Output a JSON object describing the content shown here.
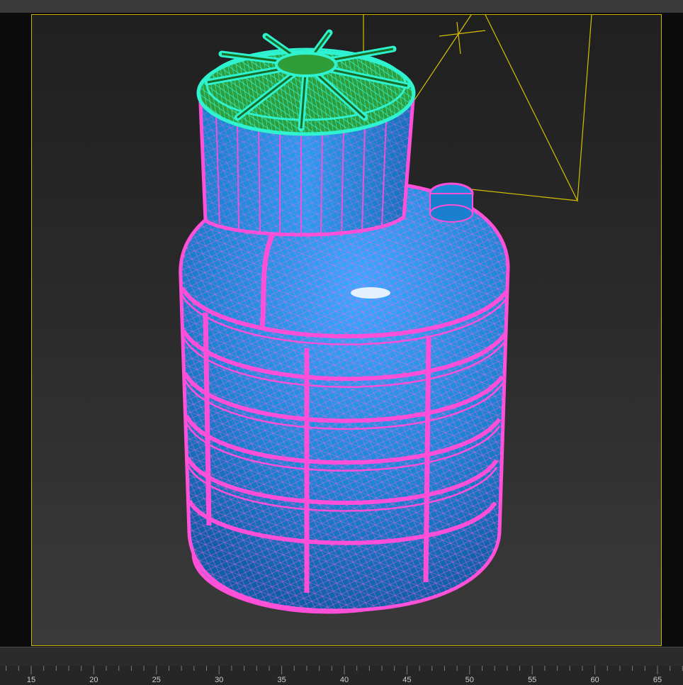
{
  "viewport": {
    "colors": {
      "frame": "#c9b200",
      "wire_pink": "#ff4fd8",
      "fill_blue": "#1e88d8",
      "lid_cyan": "#2ef2d0",
      "lid_green": "#2f9e3a"
    }
  },
  "timeline": {
    "ruler_ticks": [
      "15",
      "20",
      "25",
      "30",
      "35",
      "40",
      "45",
      "50",
      "55",
      "60",
      "65"
    ]
  }
}
